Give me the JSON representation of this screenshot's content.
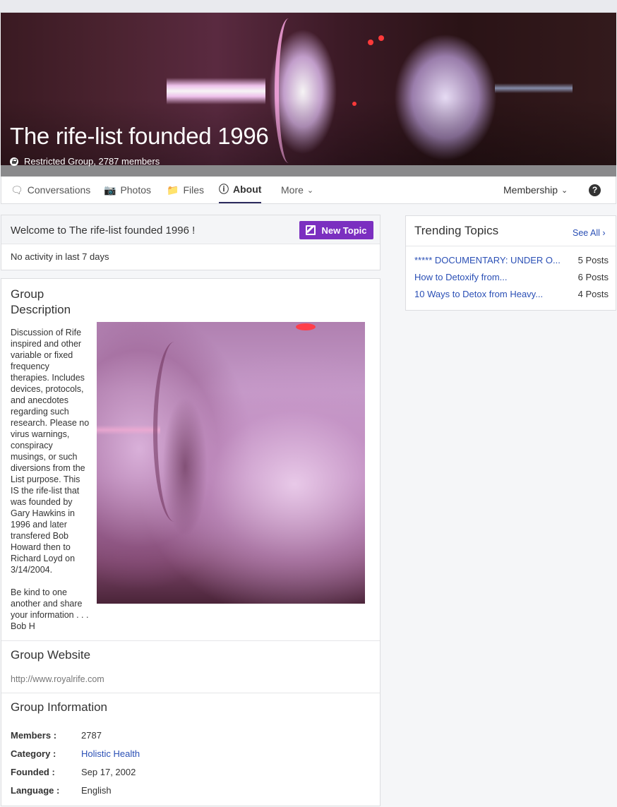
{
  "group": {
    "title": "The rife-list founded 1996",
    "meta": "Restricted Group, 2787 members"
  },
  "nav": {
    "conversations": "Conversations",
    "photos": "Photos",
    "files": "Files",
    "about": "About",
    "more": "More",
    "membership": "Membership",
    "help": "?"
  },
  "welcome": {
    "title": "Welcome to The rife-list founded 1996 !",
    "new_topic": "New Topic",
    "activity": "No activity in last 7 days"
  },
  "description": {
    "title": "Group Description",
    "text": "Discussion of Rife inspired and other variable or fixed frequency therapies. Includes devices, protocols, and anecdotes regarding such research. Please no virus warnings, conspiracy musings, or such diversions from the List purpose. This IS the rife-list that was founded by Gary Hawkins in 1996 and later transfered Bob Howard then to Richard Loyd on 3/14/2004.\n\nBe kind to one another and share your information . . . Bob H"
  },
  "website": {
    "title": "Group Website",
    "url": "http://www.royalrife.com"
  },
  "info": {
    "title": "Group Information",
    "rows": [
      {
        "key": "Members :",
        "value": "2787"
      },
      {
        "key": "Category :",
        "value": "Holistic Health"
      },
      {
        "key": "Founded :",
        "value": "Sep 17, 2002"
      },
      {
        "key": "Language :",
        "value": "English"
      }
    ]
  },
  "trending": {
    "title": "Trending Topics",
    "see_all": "See All",
    "topics": [
      {
        "title": "***** DOCUMENTARY: UNDER O...",
        "count": "5 Posts"
      },
      {
        "title": "How to Detoxify from...",
        "count": "6 Posts"
      },
      {
        "title": "10 Ways to Detox from Heavy...",
        "count": "4 Posts"
      }
    ]
  },
  "colors": {
    "accent_purple": "#7b2fc0",
    "link_blue": "#2a4fb5",
    "active_tab_underline": "#2d2b5e"
  }
}
